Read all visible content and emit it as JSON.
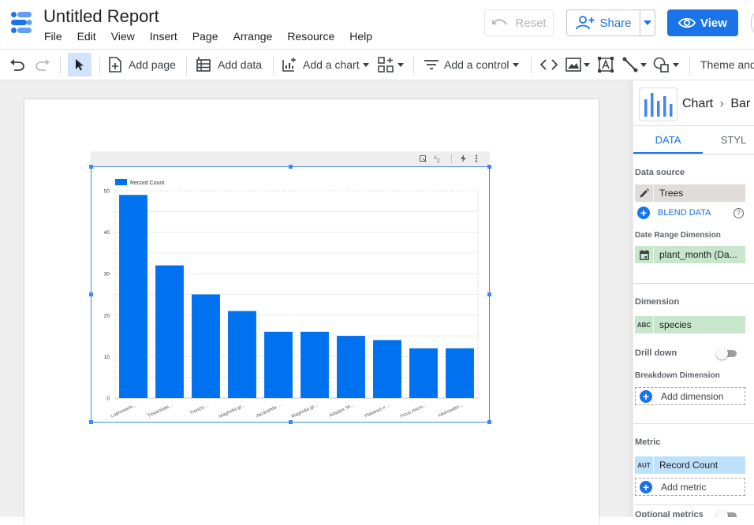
{
  "header": {
    "title": "Untitled Report",
    "menu": [
      "File",
      "Edit",
      "View",
      "Insert",
      "Page",
      "Arrange",
      "Resource",
      "Help"
    ],
    "reset_label": "Reset",
    "share_label": "Share",
    "view_label": "View"
  },
  "toolbar": {
    "add_page": "Add page",
    "add_data": "Add data",
    "add_chart": "Add a chart",
    "add_control": "Add a control",
    "theme": "Theme and"
  },
  "panel": {
    "breadcrumb_chart": "Chart",
    "breadcrumb_type": "Bar",
    "tab_data": "DATA",
    "tab_style": "STYL",
    "data_source_label": "Data source",
    "data_source_value": "Trees",
    "blend_data": "BLEND DATA",
    "date_range_label": "Date Range Dimension",
    "date_range_value": "plant_month (Da...",
    "dimension_label": "Dimension",
    "dimension_value": "species",
    "dimension_type": "ABC",
    "drill_down_label": "Drill down",
    "breakdown_label": "Breakdown Dimension",
    "add_dimension": "Add dimension",
    "metric_label": "Metric",
    "metric_type": "AUT",
    "metric_value": "Record Count",
    "add_metric": "Add metric",
    "optional_metrics": "Optional metrics"
  },
  "colors": {
    "bar": "#0072f0",
    "accent": "#1a73e8",
    "chip_grey": "#e0dcd9",
    "chip_green": "#c7e6cc",
    "chip_blue": "#bde0fb"
  },
  "chart_data": {
    "type": "bar",
    "categories": [
      "Lophostem...",
      "Tristaniops...",
      "Tree(s) ...",
      "Magnolia gr...",
      "Jacaranda ...",
      "Magnolia gr...",
      "Arbutus 'M...",
      "Platanus x ...",
      "Ficus micro...",
      "Metrosider..."
    ],
    "series": [
      {
        "name": "Record Count",
        "values": [
          49,
          32,
          25,
          21,
          16,
          16,
          15,
          14,
          12,
          12
        ]
      }
    ],
    "yticks": [
      "0",
      "10",
      "20",
      "30",
      "40",
      "50"
    ],
    "ylim": [
      0,
      50
    ],
    "legend": "top-left",
    "grid": true
  }
}
